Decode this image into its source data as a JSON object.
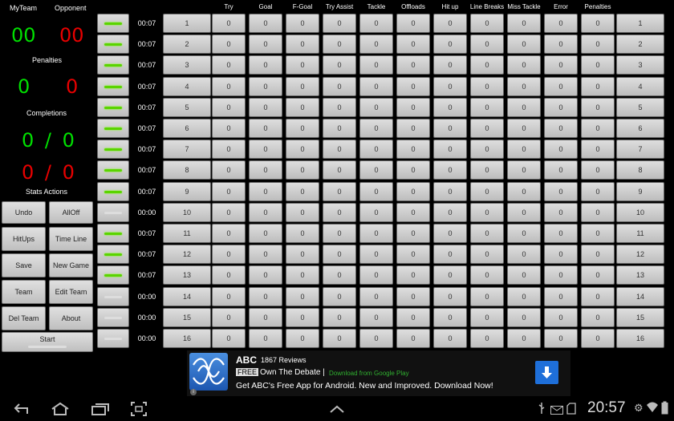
{
  "team": {
    "my_label": "MyTeam",
    "opp_label": "Opponent",
    "my_score": "00",
    "opp_score": "00",
    "penalties_label": "Penalties",
    "my_pen": "0",
    "opp_pen": "0",
    "completions_label": "Completions",
    "my_comp": "0",
    "my_comp_total": "0",
    "opp_comp": "0",
    "opp_comp_total": "0",
    "slash": "/"
  },
  "actions": {
    "title": "Stats Actions",
    "undo": "Undo",
    "alloff": "AllOff",
    "hitups": "HitUps",
    "timeline": "Time Line",
    "save": "Save",
    "newgame": "New Game",
    "team": "Team",
    "editteam": "Edit Team",
    "delteam": "Del Team",
    "about": "About",
    "start": "Start"
  },
  "columns": [
    "Try",
    "Goal",
    "F-Goal",
    "Try Assist",
    "Tackle",
    "Offloads",
    "Hit up",
    "Line Breaks",
    "Miss Tackle",
    "Error",
    "Penalties"
  ],
  "players": [
    {
      "num": "1",
      "time": "00:07",
      "on": true,
      "stats": [
        "0",
        "0",
        "0",
        "0",
        "0",
        "0",
        "0",
        "0",
        "0",
        "0",
        "0"
      ]
    },
    {
      "num": "2",
      "time": "00:07",
      "on": true,
      "stats": [
        "0",
        "0",
        "0",
        "0",
        "0",
        "0",
        "0",
        "0",
        "0",
        "0",
        "0"
      ]
    },
    {
      "num": "3",
      "time": "00:07",
      "on": true,
      "stats": [
        "0",
        "0",
        "0",
        "0",
        "0",
        "0",
        "0",
        "0",
        "0",
        "0",
        "0"
      ]
    },
    {
      "num": "4",
      "time": "00:07",
      "on": true,
      "stats": [
        "0",
        "0",
        "0",
        "0",
        "0",
        "0",
        "0",
        "0",
        "0",
        "0",
        "0"
      ]
    },
    {
      "num": "5",
      "time": "00:07",
      "on": true,
      "stats": [
        "0",
        "0",
        "0",
        "0",
        "0",
        "0",
        "0",
        "0",
        "0",
        "0",
        "0"
      ]
    },
    {
      "num": "6",
      "time": "00:07",
      "on": true,
      "stats": [
        "0",
        "0",
        "0",
        "0",
        "0",
        "0",
        "0",
        "0",
        "0",
        "0",
        "0"
      ]
    },
    {
      "num": "7",
      "time": "00:07",
      "on": true,
      "stats": [
        "0",
        "0",
        "0",
        "0",
        "0",
        "0",
        "0",
        "0",
        "0",
        "0",
        "0"
      ]
    },
    {
      "num": "8",
      "time": "00:07",
      "on": true,
      "stats": [
        "0",
        "0",
        "0",
        "0",
        "0",
        "0",
        "0",
        "0",
        "0",
        "0",
        "0"
      ]
    },
    {
      "num": "9",
      "time": "00:07",
      "on": true,
      "stats": [
        "0",
        "0",
        "0",
        "0",
        "0",
        "0",
        "0",
        "0",
        "0",
        "0",
        "0"
      ]
    },
    {
      "num": "10",
      "time": "00:00",
      "on": false,
      "stats": [
        "0",
        "0",
        "0",
        "0",
        "0",
        "0",
        "0",
        "0",
        "0",
        "0",
        "0"
      ]
    },
    {
      "num": "11",
      "time": "00:07",
      "on": true,
      "stats": [
        "0",
        "0",
        "0",
        "0",
        "0",
        "0",
        "0",
        "0",
        "0",
        "0",
        "0"
      ]
    },
    {
      "num": "12",
      "time": "00:07",
      "on": true,
      "stats": [
        "0",
        "0",
        "0",
        "0",
        "0",
        "0",
        "0",
        "0",
        "0",
        "0",
        "0"
      ]
    },
    {
      "num": "13",
      "time": "00:07",
      "on": true,
      "stats": [
        "0",
        "0",
        "0",
        "0",
        "0",
        "0",
        "0",
        "0",
        "0",
        "0",
        "0"
      ]
    },
    {
      "num": "14",
      "time": "00:00",
      "on": false,
      "stats": [
        "0",
        "0",
        "0",
        "0",
        "0",
        "0",
        "0",
        "0",
        "0",
        "0",
        "0"
      ]
    },
    {
      "num": "15",
      "time": "00:00",
      "on": false,
      "stats": [
        "0",
        "0",
        "0",
        "0",
        "0",
        "0",
        "0",
        "0",
        "0",
        "0",
        "0"
      ]
    },
    {
      "num": "16",
      "time": "00:00",
      "on": false,
      "stats": [
        "0",
        "0",
        "0",
        "0",
        "0",
        "0",
        "0",
        "0",
        "0",
        "0",
        "0"
      ]
    }
  ],
  "ad": {
    "brand": "ABC",
    "reviews": "1867 Reviews",
    "free_badge": "FREE",
    "headline": "Own The Debate |",
    "store": "Download from Google Play",
    "tagline": "Get ABC's Free App for Android. New and Improved. Download Now!",
    "info_icon": "info-icon",
    "download_icon": "download-icon"
  },
  "statusbar": {
    "time": "20:57",
    "icons": [
      "usb-icon",
      "gmail-icon",
      "sd-card-icon",
      "settings-icon",
      "wifi-icon",
      "battery-icon"
    ]
  },
  "colors": {
    "green": "#00e000",
    "red": "#e80000",
    "toggle_on": "#5ad400",
    "ad_blue": "#1e6fd9",
    "store_green": "#30b030"
  }
}
